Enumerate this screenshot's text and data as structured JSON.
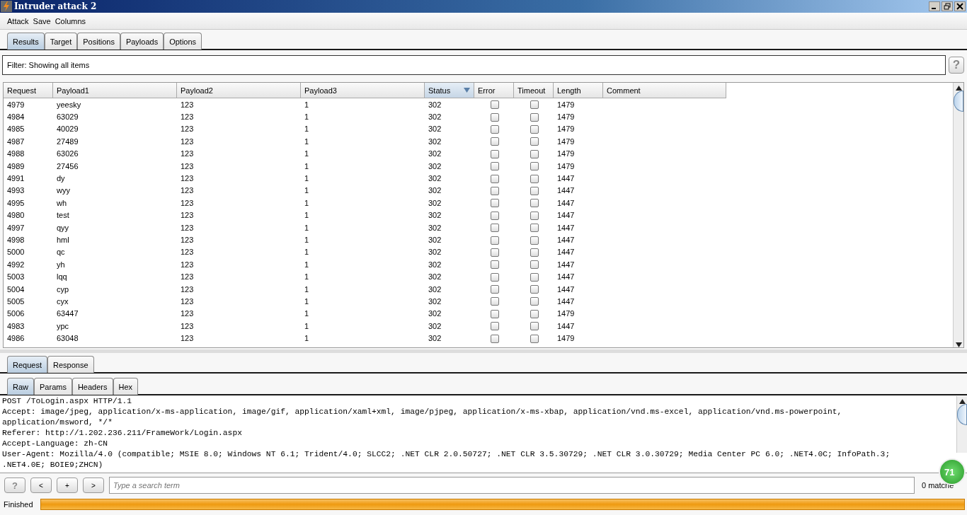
{
  "window": {
    "title": "Intruder attack 2"
  },
  "menu": [
    "Attack",
    "Save",
    "Columns"
  ],
  "tabs": [
    {
      "label": "Results",
      "selected": true
    },
    {
      "label": "Target",
      "selected": false
    },
    {
      "label": "Positions",
      "selected": false
    },
    {
      "label": "Payloads",
      "selected": false
    },
    {
      "label": "Options",
      "selected": false
    }
  ],
  "filter": {
    "label": "Filter:",
    "text": "Showing all items",
    "help": "?"
  },
  "table": {
    "columns": [
      {
        "label": "Request",
        "sorted": false
      },
      {
        "label": "Payload1",
        "sorted": false
      },
      {
        "label": "Payload2",
        "sorted": false
      },
      {
        "label": "Payload3",
        "sorted": false
      },
      {
        "label": "Status",
        "sorted": true
      },
      {
        "label": "Error",
        "sorted": false
      },
      {
        "label": "Timeout",
        "sorted": false
      },
      {
        "label": "Length",
        "sorted": false
      },
      {
        "label": "Comment",
        "sorted": false
      }
    ],
    "rows": [
      {
        "request": "4979",
        "payload1": "yeesky",
        "payload2": "123",
        "payload3": "1",
        "status": "302",
        "error": false,
        "timeout": false,
        "length": "1479"
      },
      {
        "request": "4984",
        "payload1": "63029",
        "payload2": "123",
        "payload3": "1",
        "status": "302",
        "error": false,
        "timeout": false,
        "length": "1479"
      },
      {
        "request": "4985",
        "payload1": "40029",
        "payload2": "123",
        "payload3": "1",
        "status": "302",
        "error": false,
        "timeout": false,
        "length": "1479"
      },
      {
        "request": "4987",
        "payload1": "27489",
        "payload2": "123",
        "payload3": "1",
        "status": "302",
        "error": false,
        "timeout": false,
        "length": "1479"
      },
      {
        "request": "4988",
        "payload1": "63026",
        "payload2": "123",
        "payload3": "1",
        "status": "302",
        "error": false,
        "timeout": false,
        "length": "1479"
      },
      {
        "request": "4989",
        "payload1": "27456",
        "payload2": "123",
        "payload3": "1",
        "status": "302",
        "error": false,
        "timeout": false,
        "length": "1479"
      },
      {
        "request": "4991",
        "payload1": "dy",
        "payload2": "123",
        "payload3": "1",
        "status": "302",
        "error": false,
        "timeout": false,
        "length": "1447"
      },
      {
        "request": "4993",
        "payload1": "wyy",
        "payload2": "123",
        "payload3": "1",
        "status": "302",
        "error": false,
        "timeout": false,
        "length": "1447"
      },
      {
        "request": "4995",
        "payload1": "wh",
        "payload2": "123",
        "payload3": "1",
        "status": "302",
        "error": false,
        "timeout": false,
        "length": "1447"
      },
      {
        "request": "4980",
        "payload1": "test",
        "payload2": "123",
        "payload3": "1",
        "status": "302",
        "error": false,
        "timeout": false,
        "length": "1447"
      },
      {
        "request": "4997",
        "payload1": "qyy",
        "payload2": "123",
        "payload3": "1",
        "status": "302",
        "error": false,
        "timeout": false,
        "length": "1447"
      },
      {
        "request": "4998",
        "payload1": "hml",
        "payload2": "123",
        "payload3": "1",
        "status": "302",
        "error": false,
        "timeout": false,
        "length": "1447"
      },
      {
        "request": "5000",
        "payload1": "qc",
        "payload2": "123",
        "payload3": "1",
        "status": "302",
        "error": false,
        "timeout": false,
        "length": "1447"
      },
      {
        "request": "4992",
        "payload1": "yh",
        "payload2": "123",
        "payload3": "1",
        "status": "302",
        "error": false,
        "timeout": false,
        "length": "1447"
      },
      {
        "request": "5003",
        "payload1": "lqq",
        "payload2": "123",
        "payload3": "1",
        "status": "302",
        "error": false,
        "timeout": false,
        "length": "1447"
      },
      {
        "request": "5004",
        "payload1": "cyp",
        "payload2": "123",
        "payload3": "1",
        "status": "302",
        "error": false,
        "timeout": false,
        "length": "1447"
      },
      {
        "request": "5005",
        "payload1": "cyx",
        "payload2": "123",
        "payload3": "1",
        "status": "302",
        "error": false,
        "timeout": false,
        "length": "1447"
      },
      {
        "request": "5006",
        "payload1": "63447",
        "payload2": "123",
        "payload3": "1",
        "status": "302",
        "error": false,
        "timeout": false,
        "length": "1479"
      },
      {
        "request": "4983",
        "payload1": "ypc",
        "payload2": "123",
        "payload3": "1",
        "status": "302",
        "error": false,
        "timeout": false,
        "length": "1447"
      },
      {
        "request": "4986",
        "payload1": "63048",
        "payload2": "123",
        "payload3": "1",
        "status": "302",
        "error": false,
        "timeout": false,
        "length": "1479"
      }
    ]
  },
  "message_tabs": [
    {
      "label": "Request",
      "selected": true
    },
    {
      "label": "Response",
      "selected": false
    }
  ],
  "view_tabs": [
    {
      "label": "Raw",
      "selected": true
    },
    {
      "label": "Params",
      "selected": false
    },
    {
      "label": "Headers",
      "selected": false
    },
    {
      "label": "Hex",
      "selected": false
    }
  ],
  "request_lines": [
    "POST /ToLogin.aspx HTTP/1.1",
    "Accept: image/jpeg, application/x-ms-application, image/gif, application/xaml+xml, image/pjpeg, application/x-ms-xbap, application/vnd.ms-excel, application/vnd.ms-powerpoint,",
    "application/msword, */*",
    "Referer: http://1.202.236.211/FrameWork/Login.aspx",
    "Accept-Language: zh-CN",
    "User-Agent: Mozilla/4.0 (compatible; MSIE 8.0; Windows NT 6.1; Trident/4.0; SLCC2; .NET CLR 2.0.50727; .NET CLR 3.5.30729; .NET CLR 3.0.30729; Media Center PC 6.0; .NET4.0C; InfoPath.3;",
    ".NET4.0E; BOIE9;ZHCN)"
  ],
  "search": {
    "buttons": [
      "?",
      "<",
      "+",
      ">"
    ],
    "placeholder": "Type a search term",
    "matches": "0 matche"
  },
  "badge": "71",
  "status_bar": {
    "text": "Finished",
    "level": 1
  }
}
